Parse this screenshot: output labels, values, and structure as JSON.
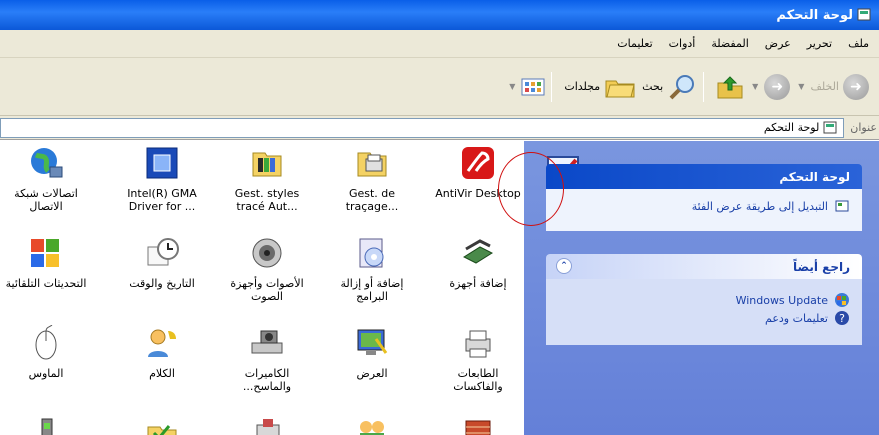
{
  "window": {
    "title": "لوحة التحكم"
  },
  "menu": {
    "items": [
      "ملف",
      "تحرير",
      "عرض",
      "المفضلة",
      "أدوات",
      "تعليمات"
    ]
  },
  "toolbar": {
    "back": "الخلف",
    "search": "بحث",
    "folders": "مجلدات"
  },
  "address": {
    "label": "عنوان",
    "value": "لوحة التحكم"
  },
  "taskpane": {
    "panel1": {
      "title": "لوحة التحكم",
      "link": "التبديل إلى طريقة عرض الفئة"
    },
    "panel2": {
      "title": "راجع أيضاً",
      "links": [
        "Windows Update",
        "تعليمات ودعم"
      ]
    }
  },
  "icons": [
    {
      "label": "AntiVir Desktop",
      "icon": "antivir-icon"
    },
    {
      "label": "Gest. de traçage...",
      "icon": "printer-driver-icon"
    },
    {
      "label": "Gest. styles tracé Aut...",
      "icon": "plot-styles-icon"
    },
    {
      "label": "Intel(R) GMA Driver for ...",
      "icon": "intel-gma-icon"
    },
    {
      "label": "اتصالات شبكة الاتصال",
      "icon": "network-connections-icon"
    },
    {
      "label": "إضافة أجهزة",
      "icon": "add-hardware-icon"
    },
    {
      "label": "إضافة أو إزالة البرامج",
      "icon": "add-remove-programs-icon"
    },
    {
      "label": "الأصوات وأجهزة الصوت",
      "icon": "sounds-icon"
    },
    {
      "label": "التاريخ والوقت",
      "icon": "date-time-icon"
    },
    {
      "label": "التحديثات التلقائية",
      "icon": "automatic-updates-icon"
    },
    {
      "label": "الطابعات والفاكسات",
      "icon": "printers-faxes-icon"
    },
    {
      "label": "العرض",
      "icon": "display-icon"
    },
    {
      "label": "الكاميرات والماسح...",
      "icon": "scanners-cameras-icon"
    },
    {
      "label": "الكلام",
      "icon": "speech-icon"
    },
    {
      "label": "الماوس",
      "icon": "mouse-icon"
    }
  ]
}
